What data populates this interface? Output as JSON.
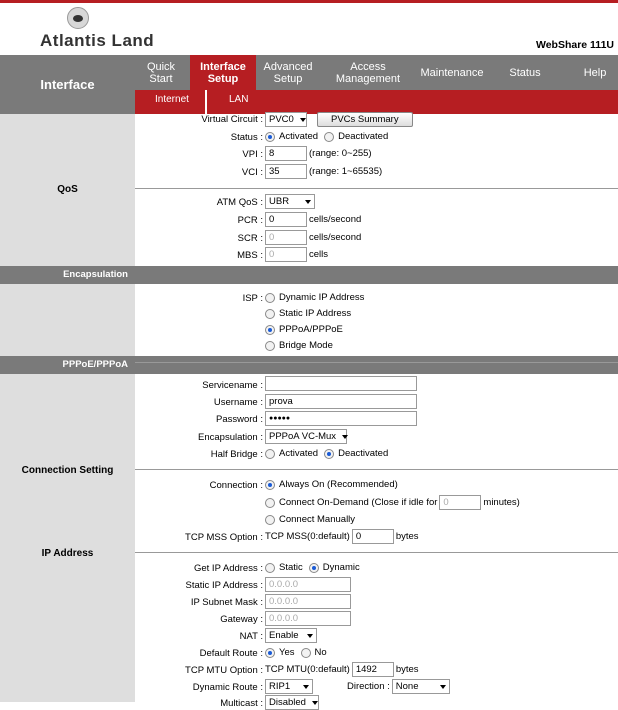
{
  "brand": {
    "logo_text": "Atlantis Land",
    "model": "WebShare 111U"
  },
  "nav": {
    "title": "Interface",
    "tabs": [
      {
        "label": "Quick\nStart"
      },
      {
        "label": "Interface\nSetup"
      },
      {
        "label": "Advanced\nSetup"
      },
      {
        "label": "Access\nManagement"
      },
      {
        "label": "Maintenance"
      },
      {
        "label": "Status"
      },
      {
        "label": "Help"
      }
    ],
    "subtabs": [
      "Internet",
      "LAN"
    ]
  },
  "sections": {
    "qos": "QoS",
    "encapsulation": "Encapsulation",
    "pppoe": "PPPoE/PPPoA",
    "connection": "Connection Setting",
    "ip": "IP Address"
  },
  "vc": {
    "label": "Virtual Circuit :",
    "value": "PVC0",
    "button": "PVCs Summary"
  },
  "status": {
    "label": "Status :",
    "activated": "Activated",
    "deactivated": "Deactivated"
  },
  "vpi": {
    "label": "VPI :",
    "value": "8",
    "range": "(range: 0~255)"
  },
  "vci": {
    "label": "VCI :",
    "value": "35",
    "range": "(range: 1~65535)"
  },
  "atmqos": {
    "label": "ATM QoS :",
    "value": "UBR"
  },
  "pcr": {
    "label": "PCR :",
    "value": "0",
    "unit": "cells/second"
  },
  "scr": {
    "label": "SCR :",
    "value": "0",
    "unit": "cells/second"
  },
  "mbs": {
    "label": "MBS :",
    "value": "0",
    "unit": "cells"
  },
  "isp": {
    "label": "ISP :",
    "options": [
      "Dynamic IP Address",
      "Static IP Address",
      "PPPoA/PPPoE",
      "Bridge Mode"
    ]
  },
  "servicename": {
    "label": "Servicename :",
    "value": ""
  },
  "username": {
    "label": "Username :",
    "value": "prova"
  },
  "password": {
    "label": "Password :",
    "value": "●●●●●"
  },
  "encap": {
    "label": "Encapsulation :",
    "value": "PPPoA VC-Mux"
  },
  "halfbridge": {
    "label": "Half Bridge :",
    "activated": "Activated",
    "deactivated": "Deactivated"
  },
  "connection": {
    "label": "Connection :",
    "always": "Always On (Recommended)",
    "ondemand": "Connect On-Demand (Close if idle for",
    "idle_value": "0",
    "minutes": "minutes)",
    "manual": "Connect Manually"
  },
  "tcpmss": {
    "label": "TCP MSS Option :",
    "prefix": "TCP MSS(0:default)",
    "value": "0",
    "unit": "bytes"
  },
  "getip": {
    "label": "Get IP Address :",
    "static": "Static",
    "dynamic": "Dynamic"
  },
  "staticip": {
    "label": "Static IP Address :",
    "value": "0.0.0.0"
  },
  "subnet": {
    "label": "IP Subnet Mask :",
    "value": "0.0.0.0"
  },
  "gateway": {
    "label": "Gateway :",
    "value": "0.0.0.0"
  },
  "nat": {
    "label": "NAT :",
    "value": "Enable"
  },
  "defroute": {
    "label": "Default Route :",
    "yes": "Yes",
    "no": "No"
  },
  "tcpmtu": {
    "label": "TCP MTU Option :",
    "prefix": "TCP MTU(0:default)",
    "value": "1492",
    "unit": "bytes"
  },
  "dynroute": {
    "label": "Dynamic Route :",
    "value": "RIP1",
    "direction_label": "Direction :",
    "direction": "None"
  },
  "multicast": {
    "label": "Multicast :",
    "value": "Disabled"
  }
}
